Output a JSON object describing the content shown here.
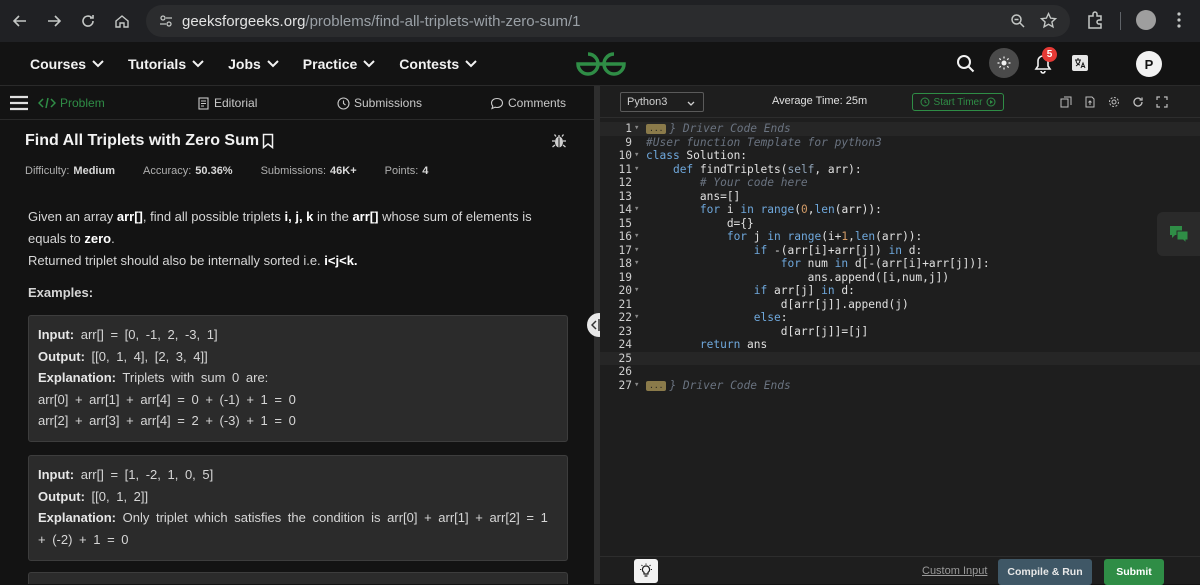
{
  "browser": {
    "url_host": "geeksforgeeks.org",
    "url_path": "/problems/find-all-triplets-with-zero-sum/1"
  },
  "site_nav": {
    "items": [
      "Courses",
      "Tutorials",
      "Jobs",
      "Practice",
      "Contests"
    ],
    "notification_count": "5",
    "avatar_letter": "P"
  },
  "tabs": [
    "Problem",
    "Editorial",
    "Submissions",
    "Comments"
  ],
  "problem": {
    "title": "Find All Triplets with Zero Sum",
    "difficulty_label": "Difficulty:",
    "difficulty": "Medium",
    "accuracy_label": "Accuracy:",
    "accuracy": "50.36%",
    "submissions_label": "Submissions:",
    "submissions": "46K+",
    "points_label": "Points:",
    "points": "4",
    "examples_heading": "Examples:"
  },
  "examples": [
    {
      "input_label": "Input:",
      "input": "arr[] = [0, -1, 2, -3, 1]",
      "output_label": "Output:",
      "output": "[[0, 1, 4], [2, 3, 4]]",
      "explanation_label": "Explanation:",
      "explanation": "Triplets with sum 0 are:",
      "extra": [
        "arr[0] + arr[1] + arr[4] = 0 + (-1) + 1 = 0",
        "arr[2] + arr[3] + arr[4] = 2 + (-3) + 1 = 0"
      ]
    },
    {
      "input_label": "Input:",
      "input": "arr[] = [1, -2, 1, 0, 5]",
      "output_label": "Output:",
      "output": "[[0, 1, 2]]",
      "explanation_label": "Explanation:",
      "explanation": "Only triplet which satisfies the condition is arr[0] + arr[1] + arr[2] = 1",
      "extra": [
        "+ (-2) + 1 = 0"
      ]
    }
  ],
  "editor": {
    "language": "Python3",
    "avg_time": "Average Time: 25m",
    "start_timer": "Start Timer",
    "custom_input": "Custom Input",
    "compile_run": "Compile & Run",
    "submit": "Submit",
    "fold_tag": "...",
    "lines": [
      {
        "n": "1",
        "fold": true,
        "code": "} Driver Code Ends",
        "type": "foldcm"
      },
      {
        "n": "9",
        "fold": false,
        "code": "#User function Template for python3",
        "type": "cm"
      },
      {
        "n": "10",
        "fold": true,
        "code": "class Solution:",
        "type": "code"
      },
      {
        "n": "11",
        "fold": true,
        "code": "    def findTriplets(self, arr):",
        "type": "code"
      },
      {
        "n": "12",
        "fold": false,
        "code": "        # Your code here",
        "type": "cm"
      },
      {
        "n": "13",
        "fold": false,
        "code": "        ans=[]",
        "type": "code"
      },
      {
        "n": "14",
        "fold": true,
        "code": "        for i in range(0,len(arr)):",
        "type": "code"
      },
      {
        "n": "15",
        "fold": false,
        "code": "            d={}",
        "type": "code"
      },
      {
        "n": "16",
        "fold": true,
        "code": "            for j in range(i+1,len(arr)):",
        "type": "code"
      },
      {
        "n": "17",
        "fold": true,
        "code": "                if -(arr[i]+arr[j]) in d:",
        "type": "code"
      },
      {
        "n": "18",
        "fold": true,
        "code": "                    for num in d[-(arr[i]+arr[j])]:",
        "type": "code"
      },
      {
        "n": "19",
        "fold": false,
        "code": "                        ans.append([i,num,j])",
        "type": "code"
      },
      {
        "n": "20",
        "fold": true,
        "code": "                if arr[j] in d:",
        "type": "code"
      },
      {
        "n": "21",
        "fold": false,
        "code": "                    d[arr[j]].append(j)",
        "type": "code"
      },
      {
        "n": "22",
        "fold": true,
        "code": "                else:",
        "type": "code"
      },
      {
        "n": "23",
        "fold": false,
        "code": "                    d[arr[j]]=[j]",
        "type": "code"
      },
      {
        "n": "24",
        "fold": false,
        "code": "        return ans",
        "type": "code"
      },
      {
        "n": "25",
        "fold": false,
        "code": "",
        "type": "code"
      },
      {
        "n": "26",
        "fold": false,
        "code": "",
        "type": "code"
      },
      {
        "n": "27",
        "fold": true,
        "code": "} Driver Code Ends",
        "type": "foldcm"
      }
    ]
  },
  "colors": {
    "brand_green": "#2f8d46",
    "notification_red": "#e53935"
  }
}
